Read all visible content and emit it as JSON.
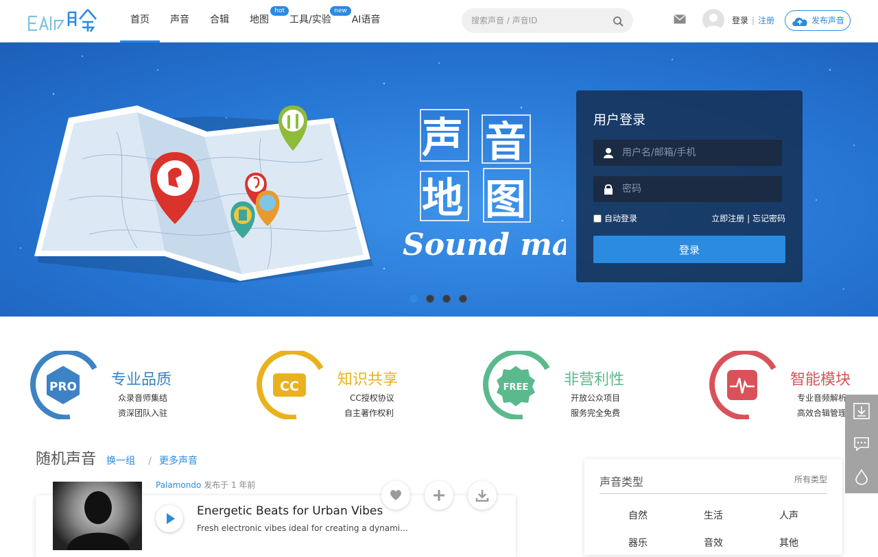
{
  "header": {
    "logo_alt": "EAR聆",
    "nav": [
      {
        "label": "首页",
        "badge": ""
      },
      {
        "label": "声音",
        "badge": ""
      },
      {
        "label": "合辑",
        "badge": ""
      },
      {
        "label": "地图",
        "badge": "hot"
      },
      {
        "label": "工具/实验",
        "badge": "new"
      },
      {
        "label": "AI语音",
        "badge": ""
      }
    ],
    "search_placeholder": "搜索声音 / 声音ID",
    "login_label": "登录",
    "separator": "|",
    "register_label": "注册",
    "publish_label": "发布声音"
  },
  "banner": {
    "title_chars": [
      "声",
      "音",
      "地",
      "图"
    ],
    "title_en": "Sound map",
    "slide_count": 4,
    "active_slide": 1
  },
  "login": {
    "title": "用户登录",
    "username_placeholder": "用户名/邮箱/手机",
    "password_placeholder": "密码",
    "auto_login": "自动登录",
    "register_link": "立即注册",
    "links_sep": "|",
    "forgot_link": "忘记密码",
    "submit": "登录"
  },
  "features": [
    {
      "badge": "PRO",
      "title": "专业品质",
      "line1": "众录音师集结",
      "line2": "资深团队入驻",
      "color": "#3d82c4"
    },
    {
      "badge": "CC",
      "title": "知识共享",
      "line1": "CC授权协议",
      "line2": "自主著作权利",
      "color": "#e9b21c"
    },
    {
      "badge": "FREE",
      "title": "非营利性",
      "line1": "开放公众项目",
      "line2": "服务完全免费",
      "color": "#5bb98e"
    },
    {
      "badge": "",
      "title": "智能模块",
      "line1": "专业音频解析",
      "line2": "高效合辑管理",
      "color": "#d9525a"
    }
  ],
  "random": {
    "title": "随机声音",
    "refresh": "换一组",
    "sep": "/",
    "more": "更多声音"
  },
  "sound": {
    "user": "Palamondo",
    "published": "发布于 1 年前",
    "title": "Energetic Beats for Urban Vibes",
    "desc": "Fresh electronic vibes ideal for creating a dynami..."
  },
  "types": {
    "title": "声音类型",
    "all": "所有类型",
    "items": [
      "自然",
      "生活",
      "人声",
      "器乐",
      "音效",
      "其他"
    ]
  },
  "icons": {
    "search": "search-icon",
    "mail": "mail-icon",
    "upload": "cloud-upload-icon",
    "user": "user-icon",
    "lock": "lock-icon",
    "play": "play-icon",
    "like": "heart-icon",
    "add": "plus-icon",
    "download": "download-icon",
    "side_download": "download-icon",
    "side_feedback": "chat-icon",
    "side_theme": "drop-icon"
  },
  "colors": {
    "accent": "#2a8be0"
  }
}
